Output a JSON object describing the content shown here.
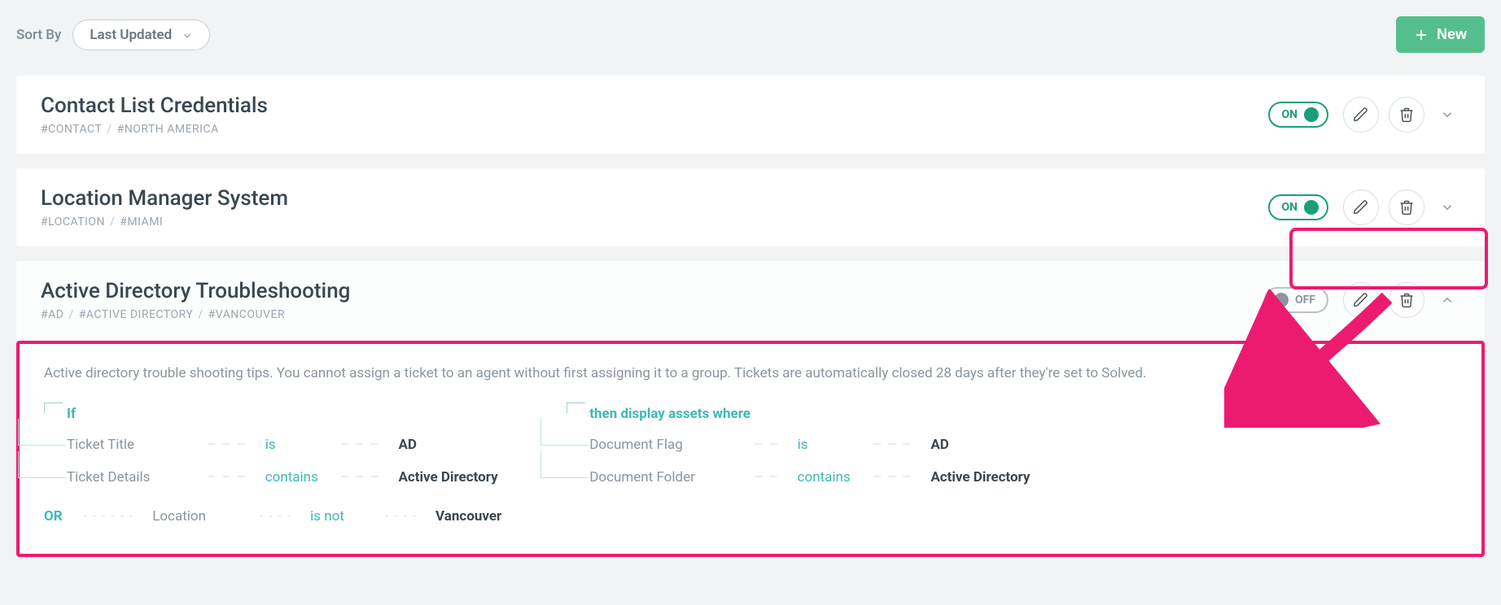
{
  "topbar": {
    "sort_label": "Sort By",
    "sort_value": "Last Updated",
    "new_label": "New"
  },
  "cards": {
    "c0": {
      "title": "Contact List Credentials",
      "tags": [
        "#CONTACT",
        "#NORTH AMERICA"
      ],
      "toggle": "ON",
      "expanded": false
    },
    "c1": {
      "title": "Location Manager System",
      "tags": [
        "#LOCATION",
        "#MIAMI"
      ],
      "toggle": "ON",
      "expanded": false
    },
    "c2": {
      "title": "Active Directory Troubleshooting",
      "tags": [
        "#AD",
        "#ACTIVE DIRECTORY",
        "#VANCOUVER"
      ],
      "toggle": "OFF",
      "expanded": true,
      "description": "Active directory trouble shooting tips. You cannot assign a ticket to an agent without first assigning it to a group. Tickets are automatically closed 28 days after they're set to Solved.",
      "if_label": "If",
      "then_label": "then display assets where",
      "or_label": "OR",
      "if_rules": [
        {
          "field": "Ticket Title",
          "op": "is",
          "val": "AD"
        },
        {
          "field": "Ticket Details",
          "op": "contains",
          "val": "Active Directory"
        }
      ],
      "or_rule": {
        "field": "Location",
        "op": "is not",
        "val": "Vancouver"
      },
      "then_rules": [
        {
          "field": "Document Flag",
          "op": "is",
          "val": "AD"
        },
        {
          "field": "Document Folder",
          "op": "contains",
          "val": "Active Directory"
        }
      ]
    }
  }
}
